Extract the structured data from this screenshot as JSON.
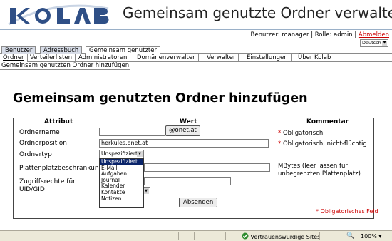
{
  "header": {
    "logo_text": "KOLAB",
    "title": "Gemeinsam genutzte Ordner verwalten",
    "user_info": "Benutzer: manager | Rolle: admin | ",
    "logout_label": "Abmelden",
    "language": "Deutsch"
  },
  "tabs_main": [
    {
      "label": "Benutzer"
    },
    {
      "label": "Adressbuch"
    },
    {
      "label": "Gemeinsam genutzter"
    }
  ],
  "tabs_sub": [
    {
      "label": "Ordner"
    },
    {
      "label": "Verteilerlisten"
    },
    {
      "label": "Administratoren"
    },
    {
      "label": "Domänenverwalter"
    },
    {
      "label": "Verwalter"
    },
    {
      "label": "Einstellungen"
    },
    {
      "label": "Über Kolab"
    }
  ],
  "subnav": "Gemeinsam genutzten Ordner hinzufügen",
  "page_title": "Gemeinsam genutzten Ordner hinzufügen",
  "form": {
    "headers": {
      "attribute": "Attribut",
      "value": "Wert",
      "comment": "Kommentar"
    },
    "rows": {
      "name": {
        "label": "Ordnername",
        "value": "",
        "button": "@onet.at",
        "comment_star": "* ",
        "comment": "Obligatorisch"
      },
      "position": {
        "label": "Ordnerposition",
        "value": "herkules.onet.at",
        "comment_star": "* ",
        "comment": "Obligatorisch, nicht-flüchtig"
      },
      "type": {
        "label": "Ordnertyp",
        "value": "Unspezifiziert"
      },
      "quota": {
        "label": "Plattenplatzbeschränkung",
        "value": "",
        "comment": "MBytes (leer lassen für unbegrenzten Plattenplatz)"
      },
      "access": {
        "label": "Zugriffsrechte für UID/GID",
        "value": ""
      }
    },
    "type_options": [
      "Unspezifiziert",
      "E-Mail",
      "Aufgaben",
      "Journal",
      "Kalender",
      "Kontakte",
      "Notizen"
    ],
    "submit_label": "Absenden",
    "required_note": "* Obligatorisches Feld"
  },
  "statusbar": {
    "trusted": "Vertrauenswürdige Sites",
    "zoom": "100%"
  },
  "colors": {
    "accent": "#4a6fa5",
    "required": "#cc0000",
    "tab_bg": "#d8dde8",
    "selected": "#0a246a"
  }
}
